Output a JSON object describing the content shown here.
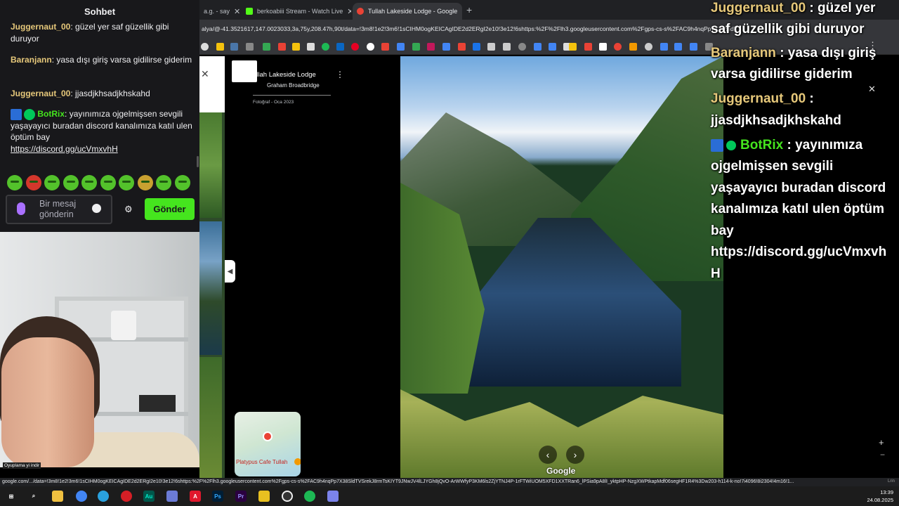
{
  "browser": {
    "tabs": [
      {
        "label": "a.g. - say",
        "icon_color": "#888888"
      },
      {
        "label": "berkoabiii Stream - Watch Live",
        "icon_color": "#53fc18"
      },
      {
        "label": "Tullah Lakeside Lodge - Google",
        "icon_color": "#ea4335"
      }
    ],
    "tab_close": "✕",
    "new_tab": "+",
    "url": "alya/@-41.3521617,147.0023033,3a,75y,208.47h,90t/data=!3m8!1e2!3m6!1sCIHM0ogKEICAgIDE2d2ERgI2e10!3e12!6shttps:%2F%2Flh3.googleusercontent.com%2Fgps-cs-s%2FAC9h4nqPp7X38SldTVSrekJ8rmTsKIYT9JNwJV4lLJYGh8jQvO-ArWWfyP3KM6ls2ZjYTNJ4P-1rFTWiUOM5XFD1XXTRan6_lPSia9pA8lI"
  },
  "maps": {
    "place_title": "ullah Lakeside Lodge",
    "author": "Graham Broadbridge",
    "photo_date": "Fotoğraf - Oca 2023",
    "minimap_label": "Platypus Cafe Tullah",
    "watermark": "Google",
    "collapse_glyph": "◀",
    "prev_glyph": "‹",
    "next_glyph": "›",
    "zoom_in": "+",
    "zoom_out": "−",
    "close_glyph": "✕",
    "kebab_glyph": "⋮"
  },
  "statusbar": {
    "url": "google.com/.../data=!3m8!1e2!3m6!1sCIHM0ogKEICAgIDE2d2ERgI2e10!3e12!6shttps:%2F%2Flh3.googleusercontent.com%2Fgps-cs-s%2FAC9h4nqPp7X38SldTVSrekJ8rmTsKIYT9JNwJV4lLJYGh8jQvO-ArWWfyP3KM6ls2ZjYTNJ4P-1rFTWiUOM5XFD1XXTRan6_lPSia9pA8lI_yktpHP-NzgXWPtkapMdf06segHF1R4%3Dw203-h114-k-no!7i4096!8i2304!4m16!1...",
    "right": "Lrin"
  },
  "chat": {
    "title": "Sohbet",
    "messages": [
      {
        "user": "Juggernaut_00",
        "text": "güzel yer saf güzellik gibi duruyor",
        "user_color": "#e6c87a"
      },
      {
        "user": "Baranjann",
        "text": "yasa dışı giriş varsa gidilirse giderim",
        "user_color": "#e6c87a"
      },
      {
        "user": "Juggernaut_00",
        "text": "jjasdjkhsadjkhskahd",
        "user_color": "#e6c87a"
      },
      {
        "user": "BotRix",
        "text": "yayınımıza ojgelmişsen sevgili yaşayayıcı buradan discord kanalımıza katıl ulen öptüm bay",
        "link": "https://discord.gg/ucVmxvhH",
        "user_color": "#45e51e"
      }
    ],
    "input_placeholder": "Bir mesaj gönderin",
    "send_label": "Gönder",
    "settings_glyph": "⚙",
    "webcam_label": "Oyuplama yi indir"
  },
  "overlay": {
    "lines": [
      {
        "user": "Juggernaut_00",
        "text": " : güzel yer"
      },
      {
        "text": "saf güzellik gibi duruyor"
      },
      {
        "user": "Baranjann",
        "text": " : yasa dışı giriş"
      },
      {
        "text": "varsa gidilirse giderim"
      },
      {
        "user": "Juggernaut_00",
        "text": " :"
      },
      {
        "text": "jjasdjkhsadjkhskahd"
      },
      {
        "user": "BotRix",
        "text": " : yayınımıza"
      },
      {
        "text": "ojgelmişsen sevgili"
      },
      {
        "text": "yaşayayıcı buradan discord"
      },
      {
        "text": "kanalımıza katıl ulen öptüm"
      },
      {
        "text": "bay"
      },
      {
        "text": "https://discord.gg/ucVmxvh"
      },
      {
        "text": "H"
      }
    ],
    "right_icons": "⋮\n✕"
  },
  "taskbar": {
    "time": "13:39",
    "date": "24.08.2025",
    "apps": [
      {
        "name": "windows-start",
        "glyph": "⊞",
        "color": "#1c1c1c"
      },
      {
        "name": "search",
        "glyph": "⌕",
        "color": "#1c1c1c"
      },
      {
        "name": "file-explorer",
        "glyph": "",
        "color": "#f0c040"
      },
      {
        "name": "chrome",
        "glyph": "",
        "color": "#4285f4"
      },
      {
        "name": "telegram",
        "glyph": "",
        "color": "#2aa1de"
      },
      {
        "name": "opera",
        "glyph": "",
        "color": "#d61f26"
      },
      {
        "name": "audition",
        "glyph": "Au",
        "color": "#00c8aa"
      },
      {
        "name": "app-a",
        "glyph": "",
        "color": "#6b7bd6"
      },
      {
        "name": "acrobat",
        "glyph": "A",
        "color": "#e0182d"
      },
      {
        "name": "photoshop",
        "glyph": "Ps",
        "color": "#31a8ff"
      },
      {
        "name": "premiere",
        "glyph": "Pr",
        "color": "#9999ff"
      },
      {
        "name": "app-yellow",
        "glyph": "",
        "color": "#e8c020"
      },
      {
        "name": "obs",
        "glyph": "",
        "color": "#333333"
      },
      {
        "name": "spotify",
        "glyph": "",
        "color": "#1db954"
      },
      {
        "name": "teams",
        "glyph": "",
        "color": "#7b83eb"
      }
    ]
  }
}
